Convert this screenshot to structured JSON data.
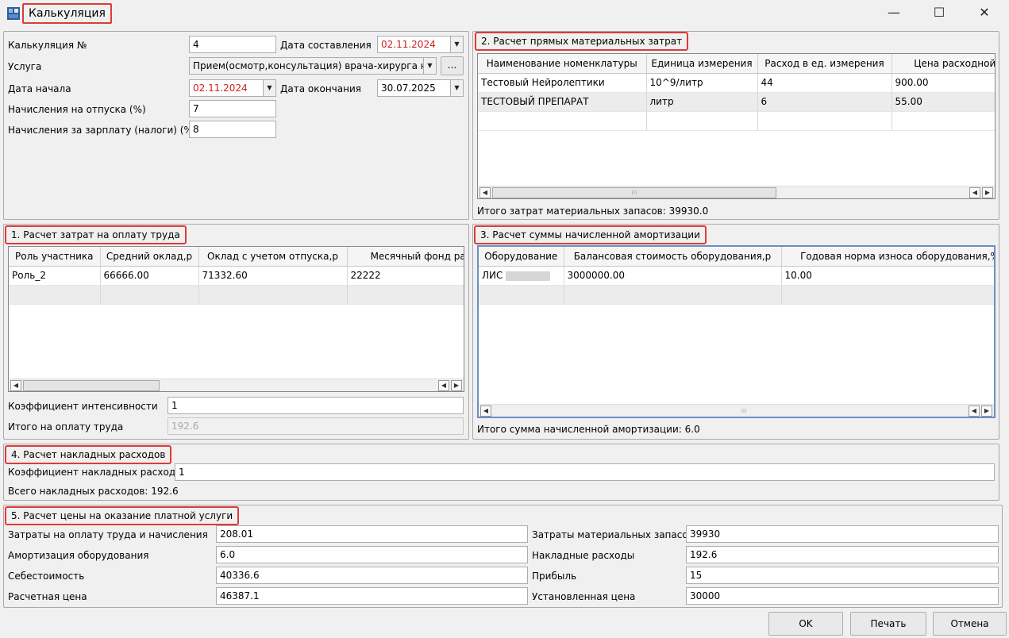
{
  "window": {
    "title": "Калькуляция",
    "minimize": "—",
    "maximize": "☐",
    "close": "✕"
  },
  "header": {
    "calc_no_label": "Калькуляция №",
    "calc_no_value": "4",
    "date_created_label": "Дата составления",
    "date_created_value": "02.11.2024",
    "service_label": "Услуга",
    "service_value": "Прием(осмотр,консультация) врача-хирурга на д",
    "service_more": "...",
    "date_start_label": "Дата начала",
    "date_start_value": "02.11.2024",
    "date_end_label": "Дата окончания",
    "date_end_value": "30.07.2025",
    "vacation_label": "Начисления на отпуска (%)",
    "vacation_value": "7",
    "salary_tax_label": "Начисления за зарплату (налоги) (%)",
    "salary_tax_value": "8"
  },
  "materials": {
    "title": "2. Расчет прямых материальных затрат",
    "columns": [
      "Наименование номенклатуры",
      "Единица измерения",
      "Расход в ед. измерения",
      "Цена расходной ед"
    ],
    "rows": [
      [
        "Тестовый Нейролептики",
        "10^9/литр",
        "44",
        "900.00"
      ],
      [
        "ТЕСТОВЫЙ ПРЕПАРАТ",
        "литр",
        "6",
        "55.00"
      ]
    ],
    "total": "Итого затрат материальных запасов: 39930.0"
  },
  "labor": {
    "title": "1. Расчет затрат на оплату труда",
    "columns": [
      "Роль участника",
      "Средний оклад,р",
      "Оклад с учетом отпуска,р",
      "Месячный фонд рабо"
    ],
    "rows": [
      [
        "Роль_2",
        "66666.00",
        "71332.60",
        "22222"
      ]
    ],
    "intensity_label": "Коэффициент интенсивности",
    "intensity_value": "1",
    "total_label": "Итого на оплату труда",
    "total_value": "192.6"
  },
  "amortization": {
    "title": "3. Расчет суммы начисленной амортизации",
    "columns": [
      "Оборудование",
      "Балансовая стоимость оборудования,р",
      "Годовая норма износа оборудования,%"
    ],
    "rows": [
      [
        "ЛИС",
        "3000000.00",
        "10.00"
      ]
    ],
    "total": "Итого сумма начисленной амортизации: 6.0"
  },
  "overhead": {
    "title": "4. Расчет накладных расходов",
    "coef_label": "Коэффициент накладных расходов",
    "coef_value": "1",
    "total": "Всего накладных расходов: 192.6"
  },
  "price": {
    "title": "5. Расчет цены на оказание платной услуги",
    "labor_label": "Затраты на оплату труда и начисления",
    "labor_value": "208.01",
    "materials_label": "Затраты материальных запасов",
    "materials_value": "39930",
    "amort_label": "Амортизация оборудования",
    "amort_value": "6.0",
    "overhead_label": "Накладные расходы",
    "overhead_value": "192.6",
    "cost_label": "Себестоимость",
    "cost_value": "40336.6",
    "profit_label": "Прибыль",
    "profit_value": "15",
    "calc_price_label": "Расчетная цена",
    "calc_price_value": "46387.1",
    "set_price_label": "Установленная цена",
    "set_price_value": "30000"
  },
  "buttons": {
    "ok": "OK",
    "print": "Печать",
    "cancel": "Отмена"
  },
  "colors": {
    "highlight_border": "#e03a3a",
    "date_text": "#d01e1e",
    "focus_border": "#6a8fc1"
  }
}
